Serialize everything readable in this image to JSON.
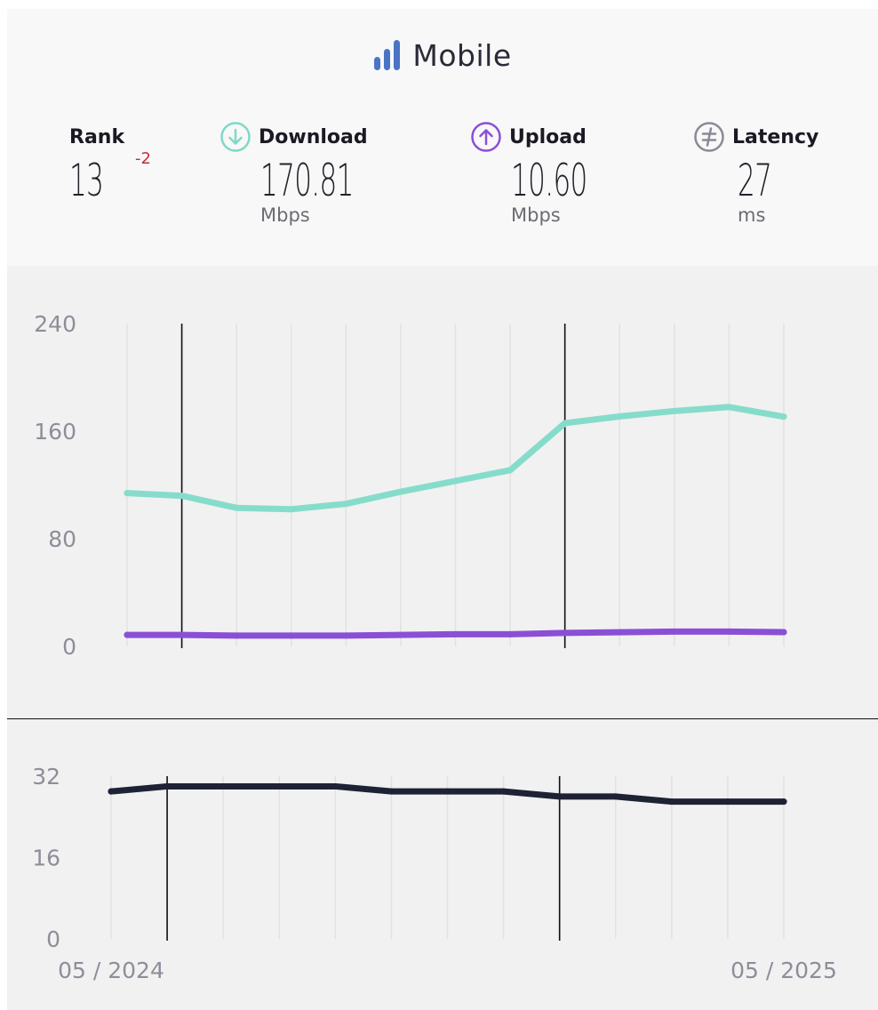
{
  "header": {
    "title": "Mobile",
    "title_icon": "bar-signal-icon",
    "accent": "#4a74c4"
  },
  "stats": {
    "rank": {
      "label": "Rank",
      "value": "13",
      "delta": "-2",
      "delta_color": "#c0303a"
    },
    "download": {
      "label": "Download",
      "value": "170.81",
      "unit": "Mbps",
      "icon": "download-circle-icon",
      "color": "#7ed9c5"
    },
    "upload": {
      "label": "Upload",
      "value": "10.60",
      "unit": "Mbps",
      "icon": "upload-circle-icon",
      "color": "#8b4fd6"
    },
    "latency": {
      "label": "Latency",
      "value": "27",
      "unit": "ms",
      "icon": "latency-circle-icon",
      "color": "#8a8a96"
    }
  },
  "chart_data": [
    {
      "type": "line",
      "ylim": [
        0,
        240
      ],
      "yticks": [
        "240",
        "160",
        "80",
        "0"
      ],
      "x": [
        "2024-05",
        "2024-06",
        "2024-07",
        "2024-08",
        "2024-09",
        "2024-10",
        "2024-11",
        "2024-12",
        "2025-01",
        "2025-02",
        "2025-03",
        "2025-04",
        "2025-05"
      ],
      "series": [
        {
          "name": "Download",
          "color": "#86dccb",
          "values": [
            114,
            112,
            103,
            102,
            106,
            115,
            123,
            131,
            166,
            171,
            175,
            178,
            170.81
          ]
        },
        {
          "name": "Upload",
          "color": "#8b4fd6",
          "values": [
            8.5,
            8.5,
            8,
            8,
            8,
            8.5,
            9,
            9,
            10,
            10.5,
            11,
            11,
            10.6
          ]
        }
      ],
      "vlines": [
        "2024-06",
        "2025-01"
      ],
      "grid": "vertical"
    },
    {
      "type": "line",
      "ylim": [
        0,
        32
      ],
      "yticks": [
        "32",
        "16",
        "0"
      ],
      "x": [
        "2024-05",
        "2024-06",
        "2024-07",
        "2024-08",
        "2024-09",
        "2024-10",
        "2024-11",
        "2024-12",
        "2025-01",
        "2025-02",
        "2025-03",
        "2025-04",
        "2025-05"
      ],
      "xtick_labels": {
        "first": "05 / 2024",
        "last": "05 / 2025"
      },
      "series": [
        {
          "name": "Latency",
          "color": "#1e2235",
          "values": [
            29,
            30,
            30,
            30,
            30,
            29,
            29,
            29,
            28,
            28,
            27,
            27,
            27
          ]
        }
      ],
      "vlines": [
        "2024-06",
        "2025-01"
      ],
      "grid": "vertical"
    }
  ]
}
